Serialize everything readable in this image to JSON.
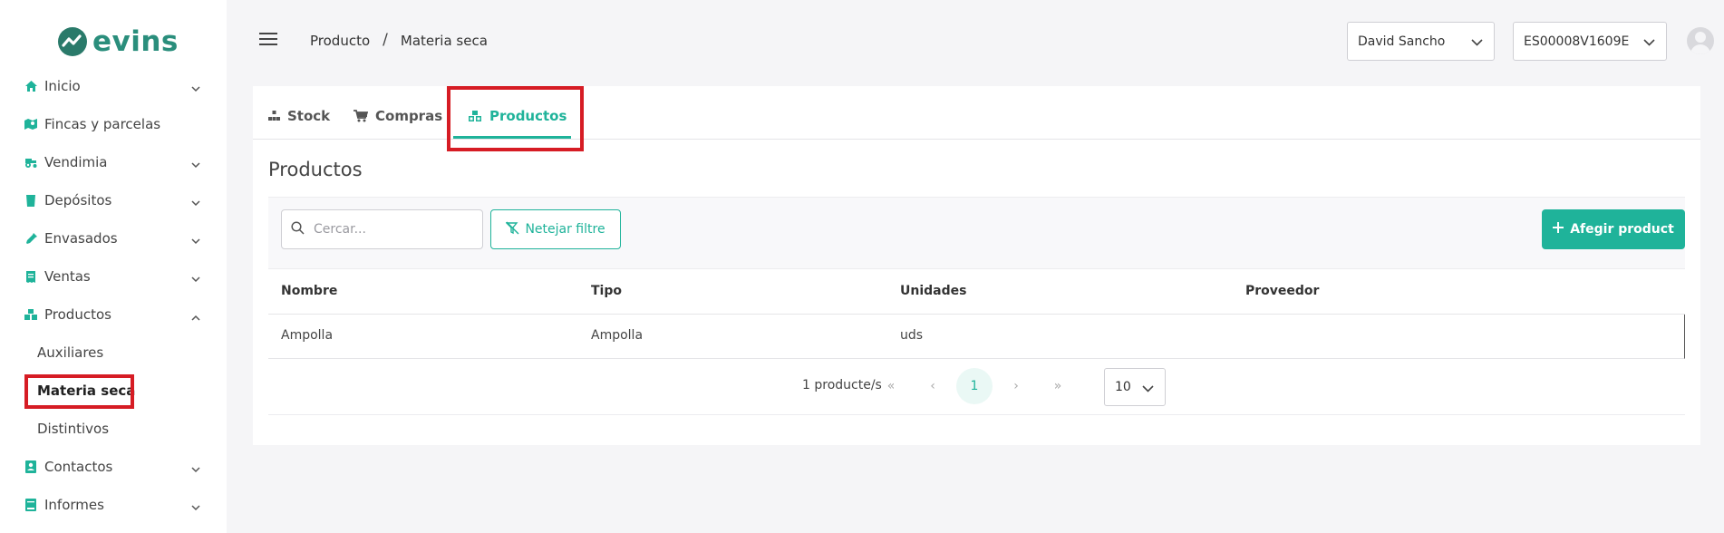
{
  "app": {
    "logo_text": "evins"
  },
  "sidebar": {
    "items": [
      {
        "label": "Inicio",
        "icon": "home-icon",
        "has_chevron": true
      },
      {
        "label": "Fincas y parcelas",
        "icon": "map-icon",
        "has_chevron": false
      },
      {
        "label": "Vendimia",
        "icon": "tractor-icon",
        "has_chevron": true
      },
      {
        "label": "Depósitos",
        "icon": "tank-icon",
        "has_chevron": true
      },
      {
        "label": "Envasados",
        "icon": "bottle-icon",
        "has_chevron": true
      },
      {
        "label": "Ventas",
        "icon": "receipt-icon",
        "has_chevron": true
      },
      {
        "label": "Productos",
        "icon": "boxes-icon",
        "has_chevron": true,
        "expanded": true
      },
      {
        "label": "Contactos",
        "icon": "contact-icon",
        "has_chevron": true
      },
      {
        "label": "Informes",
        "icon": "book-icon",
        "has_chevron": true
      }
    ],
    "sub_items": [
      {
        "label": "Auxiliares"
      },
      {
        "label": "Materia seca",
        "active": true
      },
      {
        "label": "Distintivos"
      }
    ]
  },
  "header": {
    "breadcrumb": [
      "Producto",
      "Materia seca"
    ],
    "breadcrumb_separator": "/",
    "user_select": "David Sancho",
    "winery_select": "ES00008V1609E"
  },
  "tabs": [
    {
      "label": "Stock",
      "icon": "stock-icon"
    },
    {
      "label": "Compras",
      "icon": "cart-icon"
    },
    {
      "label": "Productos",
      "icon": "boxes-icon",
      "active": true
    }
  ],
  "main": {
    "section_title": "Productos",
    "search_placeholder": "Cercar...",
    "search_value": "",
    "clear_filter_label": "Netejar filtre",
    "add_product_label": "Afegir product"
  },
  "table": {
    "columns": [
      "Nombre",
      "Tipo",
      "Unidades",
      "Proveedor"
    ],
    "rows": [
      [
        "Ampolla",
        "Ampolla",
        "uds",
        ""
      ]
    ]
  },
  "pagination": {
    "count_label": "1 producte/s",
    "first": "«",
    "prev": "‹",
    "current_page": "1",
    "next": "›",
    "last": "»",
    "page_size": "10"
  },
  "colors": {
    "accent": "#1fb39a",
    "highlight": "#d61c24",
    "logo": "#2a8e7c"
  }
}
